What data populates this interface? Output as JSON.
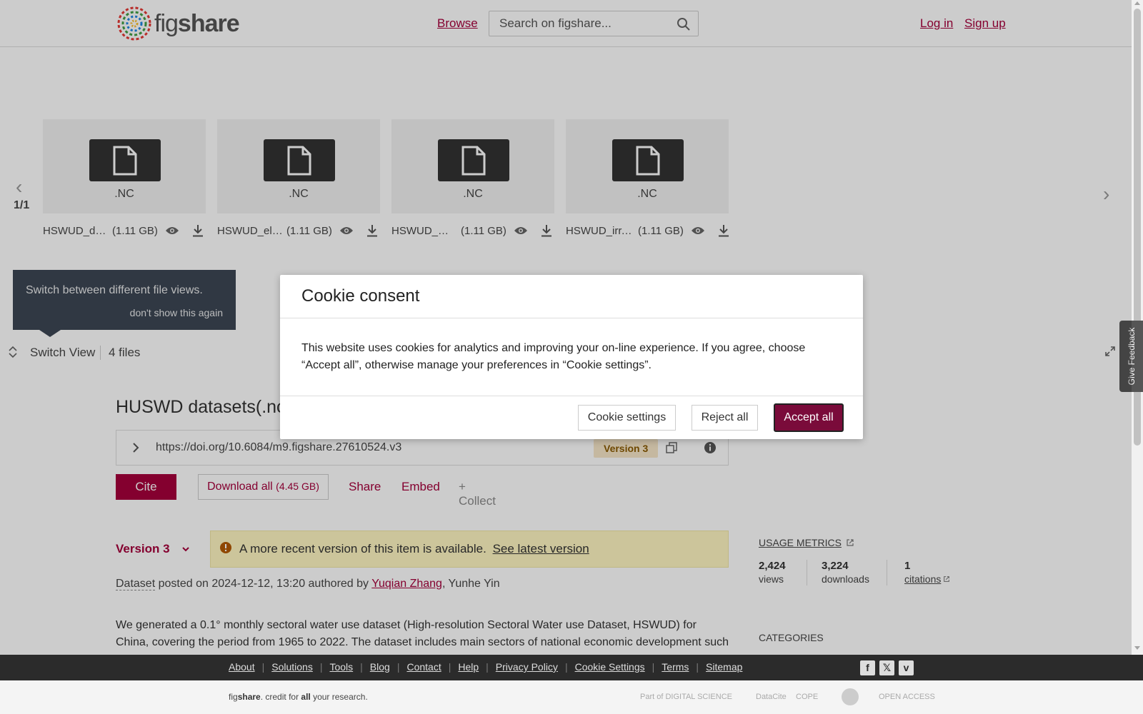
{
  "header": {
    "logo_prefix": "fig",
    "logo_suffix": "share",
    "browse": "Browse",
    "search_placeholder": "Search on figshare...",
    "login": "Log in",
    "signup": "Sign up"
  },
  "carousel": {
    "page_indicator": "1/1",
    "files": [
      {
        "ext": ".NC",
        "name": "HSWUD_do…",
        "size": "(1.11 GB)"
      },
      {
        "ext": ".NC",
        "name": "HSWUD_ele…",
        "size": "(1.11 GB)"
      },
      {
        "ext": ".NC",
        "name": "HSWUD_m…",
        "size": "(1.11 GB)"
      },
      {
        "ext": ".NC",
        "name": "HSWUD_irr.nc",
        "size": "(1.11 GB)"
      }
    ]
  },
  "tooltip": {
    "text": "Switch between different file views.",
    "dismiss": "don't show this again"
  },
  "view_bar": {
    "switch_view": "Switch View",
    "files_count": "4 files"
  },
  "item": {
    "title": "HUSWD datasets(.nc",
    "doi": "https://doi.org/10.6084/m9.figshare.27610524.v3",
    "version_badge": "Version 3",
    "cite": "Cite",
    "download_label": "Download all",
    "download_size": "(4.45 GB)",
    "share": "Share",
    "embed": "Embed",
    "collect": "+ Collect",
    "version_select": "Version 3",
    "recent_notice": "A more recent version of this item is available.",
    "see_latest": "See latest version",
    "byline_type": "Dataset",
    "byline_posted": " posted on 2024-12-12, 13:20 authored by ",
    "author1": "Yuqian Zhang",
    "author_rest": ", Yunhe Yin",
    "description": "We generated a 0.1° monthly sectoral water use dataset (High-resolution Sectoral Water use Dataset, HSWUD) for China, covering the period from 1965 to 2022. The dataset includes main sectors of national economic development such"
  },
  "sidebar": {
    "usage_title": "USAGE METRICS",
    "views_num": "2,424",
    "views_lbl": "views",
    "downloads_num": "3,224",
    "downloads_lbl": "downloads",
    "citations_num": "1",
    "citations_lbl": "citations",
    "categories_title": "CATEGORIES"
  },
  "feedback": "Give Feedback",
  "cookie": {
    "title": "Cookie consent",
    "body": "This website uses cookies for analytics and improving your on-line experience. If you agree, choose “Accept all”, otherwise manage your preferences in “Cookie settings”.",
    "settings": "Cookie settings",
    "reject": "Reject all",
    "accept": "Accept all"
  },
  "footer": {
    "links": [
      "About",
      "Solutions",
      "Tools",
      "Blog",
      "Contact",
      "Help",
      "Privacy Policy",
      "Cookie Settings",
      "Terms",
      "Sitemap"
    ],
    "tagline_pre": "fig",
    "tagline_brand": "share",
    "tagline_mid": ". credit for ",
    "tagline_all": "all",
    "tagline_post": " your research.",
    "partner_ds": "Part of DIGITAL SCIENCE",
    "partner_datacite": "DataCite",
    "partner_cope": "COPE",
    "partner_oa": "OPEN ACCESS"
  },
  "colors": {
    "brand": "#a6003b",
    "accept_button": "#7a0b3a",
    "notice_bg": "#fff7c2",
    "version_badge_bg": "#f7e7c8"
  },
  "icons": [
    "search-icon",
    "file-icon",
    "eye-icon",
    "download-icon",
    "chevron-left-icon",
    "chevron-right-icon",
    "switch-view-icon",
    "expand-icon",
    "chevron-right-icon",
    "copy-icon",
    "info-icon",
    "warning-icon",
    "chevron-down-icon",
    "external-link-icon",
    "facebook-icon",
    "x-icon",
    "vimeo-icon"
  ]
}
